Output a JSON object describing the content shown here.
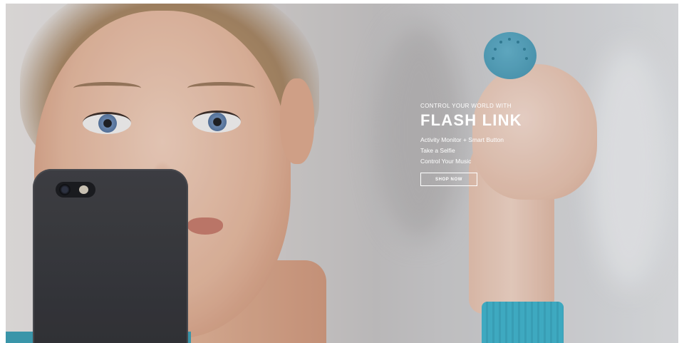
{
  "hero": {
    "eyebrow": "CONTROL YOUR WORLD WITH",
    "headline": "FLASH LINK",
    "features": [
      "Activity Monitor + Smart Button",
      "Take a Selfie",
      "Control Your Music"
    ],
    "cta_label": "SHOP NOW",
    "photo": {
      "subject": "woman-holding-phone-and-flash-link-button",
      "colors": {
        "accent_button": "#4e9fba",
        "sweater": "#3fb6cf",
        "phone": "#2e2f33",
        "text": "#ffffff"
      }
    }
  }
}
